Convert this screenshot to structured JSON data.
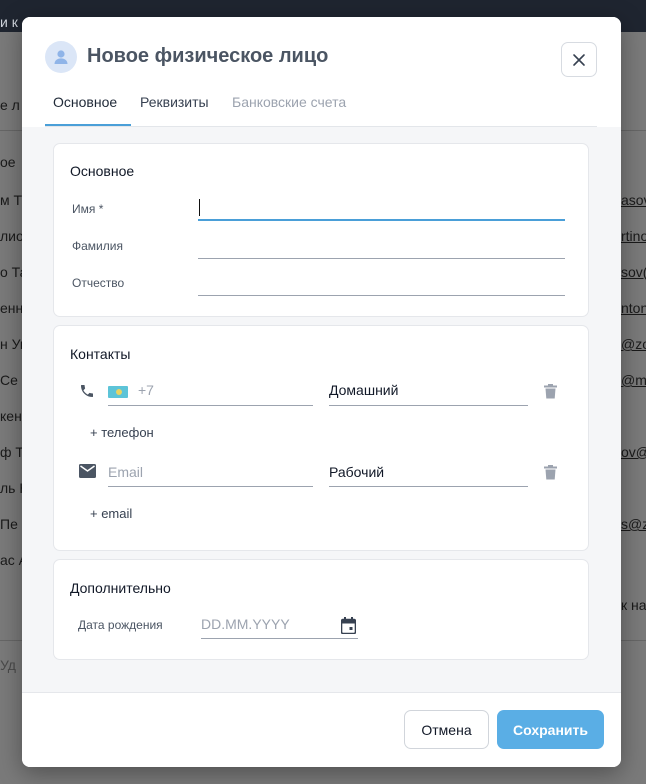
{
  "background": {
    "topbar_text": "и к",
    "left_fragments": [
      "е л",
      "ое",
      "м Т",
      "лио",
      "о Та",
      "енна",
      "н Уи",
      "Се",
      "кен",
      "ф Т",
      "ль К",
      "Пе",
      "ас А",
      "Уд"
    ],
    "right_fragments": [
      "asov",
      "rtino",
      "sov(",
      "nton",
      "@zo",
      "@m",
      "ov@",
      "s@z",
      "к на"
    ]
  },
  "modal": {
    "title": "Новое физическое лицо",
    "avatar_icon": "person-icon",
    "close_icon": "close-icon",
    "tabs": [
      {
        "label": "Основное",
        "active": true
      },
      {
        "label": "Реквизиты",
        "active": false
      },
      {
        "label": "Банковские счета",
        "active": false,
        "disabled": true
      }
    ],
    "accent_color": "#4a9fd8"
  },
  "main_section": {
    "title": "Основное",
    "fields": [
      {
        "label": "Имя *",
        "value": ""
      },
      {
        "label": "Фамилия",
        "value": ""
      },
      {
        "label": "Отчество",
        "value": ""
      }
    ]
  },
  "contacts": {
    "title": "Контакты",
    "phone": {
      "icon": "phone-icon",
      "flag": "kazakhstan-flag",
      "prefix": "+7",
      "type": "Домашний",
      "delete_icon": "trash-icon"
    },
    "add_phone": "+ телефон",
    "email": {
      "icon": "mail-icon",
      "placeholder": "Email",
      "type": "Рабочий",
      "delete_icon": "trash-icon"
    },
    "add_email": "+ email"
  },
  "additional": {
    "title": "Дополнительно",
    "birthdate_label": "Дата рождения",
    "birthdate_placeholder": "DD.MM.YYYY",
    "calendar_icon": "calendar-icon"
  },
  "footer": {
    "cancel_label": "Отмена",
    "save_label": "Сохранить",
    "save_color": "#5aaee5"
  }
}
